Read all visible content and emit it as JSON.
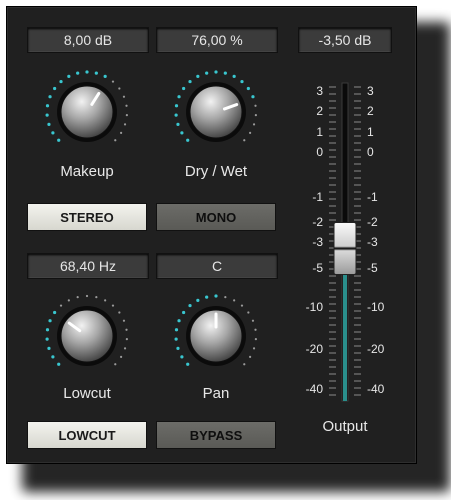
{
  "displays": {
    "makeup": "8,00 dB",
    "drywet": "76,00 %",
    "output": "-3,50 dB",
    "lowcut": "68,40 Hz",
    "pan": "C"
  },
  "knobs": {
    "makeup_label": "Makeup",
    "drywet_label": "Dry / Wet",
    "lowcut_label": "Lowcut",
    "pan_label": "Pan",
    "makeup_level": 0.62,
    "drywet_level": 0.76,
    "lowcut_level": 0.3,
    "pan_level": 0.5
  },
  "buttons": {
    "stereo": "STEREO",
    "mono": "MONO",
    "lowcut": "LOWCUT",
    "bypass": "BYPASS"
  },
  "fader": {
    "label": "Output",
    "scale": [
      "3",
      "2",
      "1",
      "0",
      "-1",
      "-2",
      "-3",
      "-5",
      "-10",
      "-20",
      "-40"
    ],
    "value_db": -3.5
  },
  "colors": {
    "panel": "#202020",
    "accent_dots": "#39c6cf",
    "button_on": "#e8e8e0",
    "button_off": "#606060"
  }
}
